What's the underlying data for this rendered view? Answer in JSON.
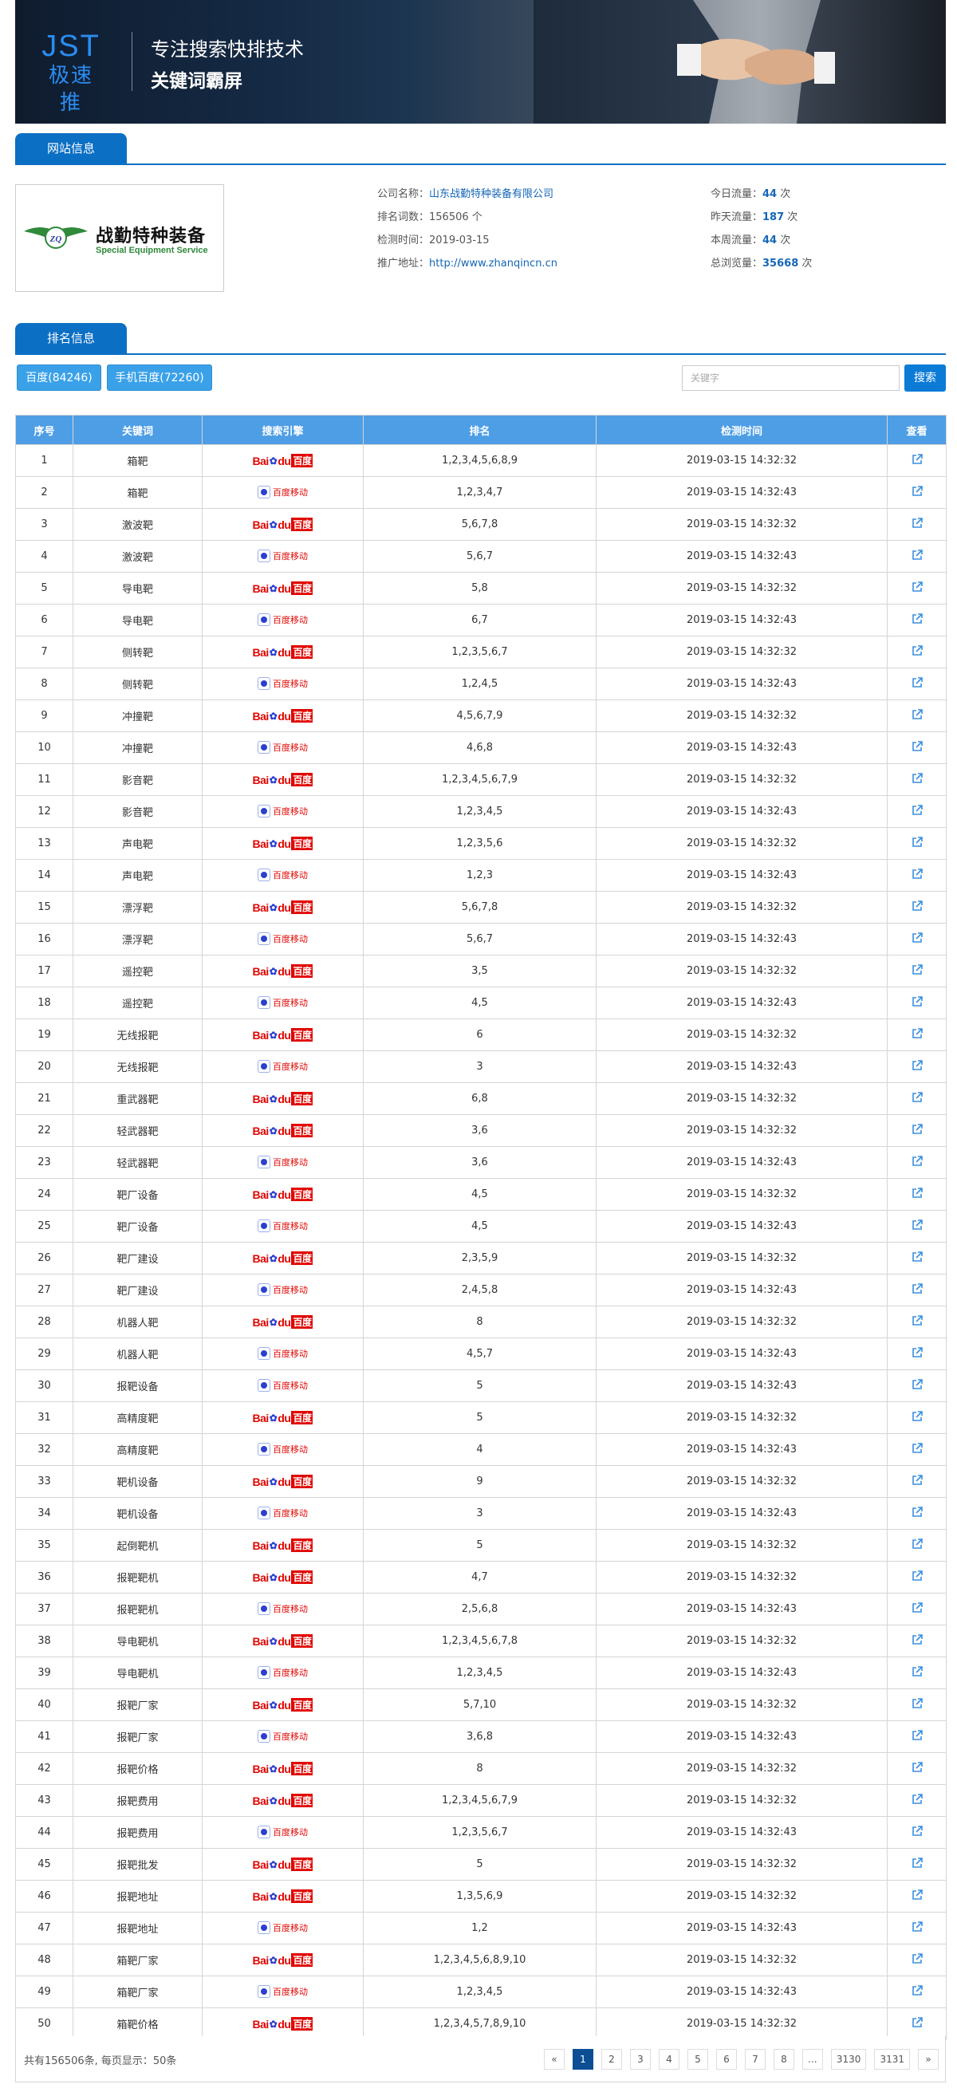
{
  "banner": {
    "logo_top": "JST",
    "logo_sub": "极速推",
    "slogan1": "专注搜索快排技术",
    "slogan2": "关键词霸屏"
  },
  "site_tab": "网站信息",
  "rank_tab": "排名信息",
  "company_logo": {
    "cn": "战勤特种装备",
    "en": "Special Equipment Service"
  },
  "info": {
    "company_label": "公司名称：",
    "company": "山东战勤特种装备有限公司",
    "keywords_label": "排名词数：",
    "keywords": "156506",
    "keywords_unit": "个",
    "checked_label": "检测时间：",
    "checked": "2019-03-15",
    "url_label": "推广地址：",
    "url": "http://www.zhanqincn.cn",
    "today_label": "今日流量：",
    "today": "44",
    "yesterday_label": "昨天流量：",
    "yesterday": "187",
    "week_label": "本周流量：",
    "week": "44",
    "total_label": "总浏览量：",
    "total": "35668",
    "unit": "次"
  },
  "filters": {
    "baidu": "百度(84246)",
    "mobile": "手机百度(72260)",
    "search_placeholder": "关键字",
    "search_button": "搜索"
  },
  "table": {
    "headers": [
      "序号",
      "关键词",
      "搜索引擎",
      "排名",
      "检测时间",
      "查看"
    ],
    "engine_baidu": "百度",
    "engine_mobile": "百度移动",
    "rows": [
      {
        "no": "1",
        "kw": "箱靶",
        "se": "baidu",
        "rank": "1,2,3,4,5,6,8,9",
        "time": "2019-03-15 14:32:32"
      },
      {
        "no": "2",
        "kw": "箱靶",
        "se": "mobile",
        "rank": "1,2,3,4,7",
        "time": "2019-03-15 14:32:43"
      },
      {
        "no": "3",
        "kw": "激波靶",
        "se": "baidu",
        "rank": "5,6,7,8",
        "time": "2019-03-15 14:32:32"
      },
      {
        "no": "4",
        "kw": "激波靶",
        "se": "mobile",
        "rank": "5,6,7",
        "time": "2019-03-15 14:32:43"
      },
      {
        "no": "5",
        "kw": "导电靶",
        "se": "baidu",
        "rank": "5,8",
        "time": "2019-03-15 14:32:32"
      },
      {
        "no": "6",
        "kw": "导电靶",
        "se": "mobile",
        "rank": "6,7",
        "time": "2019-03-15 14:32:43"
      },
      {
        "no": "7",
        "kw": "侧转靶",
        "se": "baidu",
        "rank": "1,2,3,5,6,7",
        "time": "2019-03-15 14:32:32"
      },
      {
        "no": "8",
        "kw": "侧转靶",
        "se": "mobile",
        "rank": "1,2,4,5",
        "time": "2019-03-15 14:32:43"
      },
      {
        "no": "9",
        "kw": "冲撞靶",
        "se": "baidu",
        "rank": "4,5,6,7,9",
        "time": "2019-03-15 14:32:32"
      },
      {
        "no": "10",
        "kw": "冲撞靶",
        "se": "mobile",
        "rank": "4,6,8",
        "time": "2019-03-15 14:32:43"
      },
      {
        "no": "11",
        "kw": "影音靶",
        "se": "baidu",
        "rank": "1,2,3,4,5,6,7,9",
        "time": "2019-03-15 14:32:32"
      },
      {
        "no": "12",
        "kw": "影音靶",
        "se": "mobile",
        "rank": "1,2,3,4,5",
        "time": "2019-03-15 14:32:43"
      },
      {
        "no": "13",
        "kw": "声电靶",
        "se": "baidu",
        "rank": "1,2,3,5,6",
        "time": "2019-03-15 14:32:32"
      },
      {
        "no": "14",
        "kw": "声电靶",
        "se": "mobile",
        "rank": "1,2,3",
        "time": "2019-03-15 14:32:43"
      },
      {
        "no": "15",
        "kw": "漂浮靶",
        "se": "baidu",
        "rank": "5,6,7,8",
        "time": "2019-03-15 14:32:32"
      },
      {
        "no": "16",
        "kw": "漂浮靶",
        "se": "mobile",
        "rank": "5,6,7",
        "time": "2019-03-15 14:32:43"
      },
      {
        "no": "17",
        "kw": "遥控靶",
        "se": "baidu",
        "rank": "3,5",
        "time": "2019-03-15 14:32:32"
      },
      {
        "no": "18",
        "kw": "遥控靶",
        "se": "mobile",
        "rank": "4,5",
        "time": "2019-03-15 14:32:43"
      },
      {
        "no": "19",
        "kw": "无线报靶",
        "se": "baidu",
        "rank": "6",
        "time": "2019-03-15 14:32:32"
      },
      {
        "no": "20",
        "kw": "无线报靶",
        "se": "mobile",
        "rank": "3",
        "time": "2019-03-15 14:32:43"
      },
      {
        "no": "21",
        "kw": "重武器靶",
        "se": "baidu",
        "rank": "6,8",
        "time": "2019-03-15 14:32:32"
      },
      {
        "no": "22",
        "kw": "轻武器靶",
        "se": "baidu",
        "rank": "3,6",
        "time": "2019-03-15 14:32:32"
      },
      {
        "no": "23",
        "kw": "轻武器靶",
        "se": "mobile",
        "rank": "3,6",
        "time": "2019-03-15 14:32:43"
      },
      {
        "no": "24",
        "kw": "靶厂设备",
        "se": "baidu",
        "rank": "4,5",
        "time": "2019-03-15 14:32:32"
      },
      {
        "no": "25",
        "kw": "靶厂设备",
        "se": "mobile",
        "rank": "4,5",
        "time": "2019-03-15 14:32:43"
      },
      {
        "no": "26",
        "kw": "靶厂建设",
        "se": "baidu",
        "rank": "2,3,5,9",
        "time": "2019-03-15 14:32:32"
      },
      {
        "no": "27",
        "kw": "靶厂建设",
        "se": "mobile",
        "rank": "2,4,5,8",
        "time": "2019-03-15 14:32:43"
      },
      {
        "no": "28",
        "kw": "机器人靶",
        "se": "baidu",
        "rank": "8",
        "time": "2019-03-15 14:32:32"
      },
      {
        "no": "29",
        "kw": "机器人靶",
        "se": "mobile",
        "rank": "4,5,7",
        "time": "2019-03-15 14:32:43"
      },
      {
        "no": "30",
        "kw": "报靶设备",
        "se": "mobile",
        "rank": "5",
        "time": "2019-03-15 14:32:43"
      },
      {
        "no": "31",
        "kw": "高精度靶",
        "se": "baidu",
        "rank": "5",
        "time": "2019-03-15 14:32:32"
      },
      {
        "no": "32",
        "kw": "高精度靶",
        "se": "mobile",
        "rank": "4",
        "time": "2019-03-15 14:32:43"
      },
      {
        "no": "33",
        "kw": "靶机设备",
        "se": "baidu",
        "rank": "9",
        "time": "2019-03-15 14:32:32"
      },
      {
        "no": "34",
        "kw": "靶机设备",
        "se": "mobile",
        "rank": "3",
        "time": "2019-03-15 14:32:43"
      },
      {
        "no": "35",
        "kw": "起倒靶机",
        "se": "baidu",
        "rank": "5",
        "time": "2019-03-15 14:32:32"
      },
      {
        "no": "36",
        "kw": "报靶靶机",
        "se": "baidu",
        "rank": "4,7",
        "time": "2019-03-15 14:32:32"
      },
      {
        "no": "37",
        "kw": "报靶靶机",
        "se": "mobile",
        "rank": "2,5,6,8",
        "time": "2019-03-15 14:32:43"
      },
      {
        "no": "38",
        "kw": "导电靶机",
        "se": "baidu",
        "rank": "1,2,3,4,5,6,7,8",
        "time": "2019-03-15 14:32:32"
      },
      {
        "no": "39",
        "kw": "导电靶机",
        "se": "mobile",
        "rank": "1,2,3,4,5",
        "time": "2019-03-15 14:32:43"
      },
      {
        "no": "40",
        "kw": "报靶厂家",
        "se": "baidu",
        "rank": "5,7,10",
        "time": "2019-03-15 14:32:32"
      },
      {
        "no": "41",
        "kw": "报靶厂家",
        "se": "mobile",
        "rank": "3,6,8",
        "time": "2019-03-15 14:32:43"
      },
      {
        "no": "42",
        "kw": "报靶价格",
        "se": "baidu",
        "rank": "8",
        "time": "2019-03-15 14:32:32"
      },
      {
        "no": "43",
        "kw": "报靶费用",
        "se": "baidu",
        "rank": "1,2,3,4,5,6,7,9",
        "time": "2019-03-15 14:32:32"
      },
      {
        "no": "44",
        "kw": "报靶费用",
        "se": "mobile",
        "rank": "1,2,3,5,6,7",
        "time": "2019-03-15 14:32:43"
      },
      {
        "no": "45",
        "kw": "报靶批发",
        "se": "baidu",
        "rank": "5",
        "time": "2019-03-15 14:32:32"
      },
      {
        "no": "46",
        "kw": "报靶地址",
        "se": "baidu",
        "rank": "1,3,5,6,9",
        "time": "2019-03-15 14:32:32"
      },
      {
        "no": "47",
        "kw": "报靶地址",
        "se": "mobile",
        "rank": "1,2",
        "time": "2019-03-15 14:32:43"
      },
      {
        "no": "48",
        "kw": "箱靶厂家",
        "se": "baidu",
        "rank": "1,2,3,4,5,6,8,9,10",
        "time": "2019-03-15 14:32:32"
      },
      {
        "no": "49",
        "kw": "箱靶厂家",
        "se": "mobile",
        "rank": "1,2,3,4,5",
        "time": "2019-03-15 14:32:43"
      },
      {
        "no": "50",
        "kw": "箱靶价格",
        "se": "baidu",
        "rank": "1,2,3,4,5,7,8,9,10",
        "time": "2019-03-15 14:32:32"
      }
    ]
  },
  "footer": {
    "summary": "共有156506条, 每页显示：50条",
    "pages": [
      "«",
      "1",
      "2",
      "3",
      "4",
      "5",
      "6",
      "7",
      "8",
      "...",
      "3130",
      "3131",
      "»"
    ],
    "current_page": "1"
  },
  "colors": {
    "primary": "#0b6fc4",
    "header_bg": "#4e9ee6",
    "link": "#1566b6",
    "baidu_red": "#e10602",
    "baidu_blue": "#2c3fcf"
  }
}
